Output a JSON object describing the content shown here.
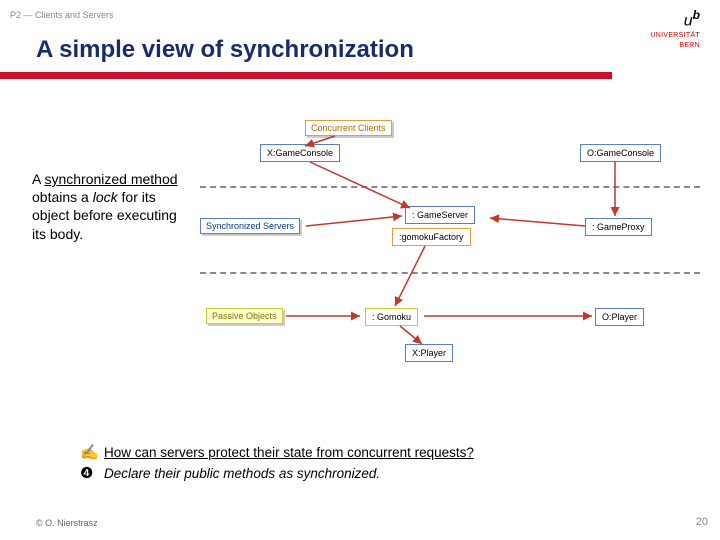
{
  "breadcrumb": "P2 — Clients and Servers",
  "logo": {
    "u": "u",
    "b": "b",
    "line1": "UNIVERSITÄT",
    "line2": "BERN"
  },
  "title": "A simple view of synchronization",
  "sidenote": {
    "t1": "A ",
    "sync": "synchronized method",
    "t2": " obtains a ",
    "lock": "lock",
    "t3": " for its object before executing its body."
  },
  "diagram": {
    "tags": {
      "concurrent": "Concurrent Clients",
      "syncserv": "Synchronized Servers",
      "passive": "Passive Objects"
    },
    "nodes": {
      "xconsole": "X:GameConsole",
      "oconsole": "O:GameConsole",
      "gserver": ": GameServer",
      "gfactory": ":gomokuFactory",
      "gproxy": ": GameProxy",
      "gomoku": ": Gomoku",
      "xplayer": "X:Player",
      "oplayer": "O:Player"
    }
  },
  "qa": {
    "bullet_q": "✍",
    "bullet_a": "❹",
    "question": "How can servers protect their state from concurrent requests?",
    "answer": "Declare their public methods as synchronized."
  },
  "footer": "© O. Nierstrasz",
  "page": "20"
}
